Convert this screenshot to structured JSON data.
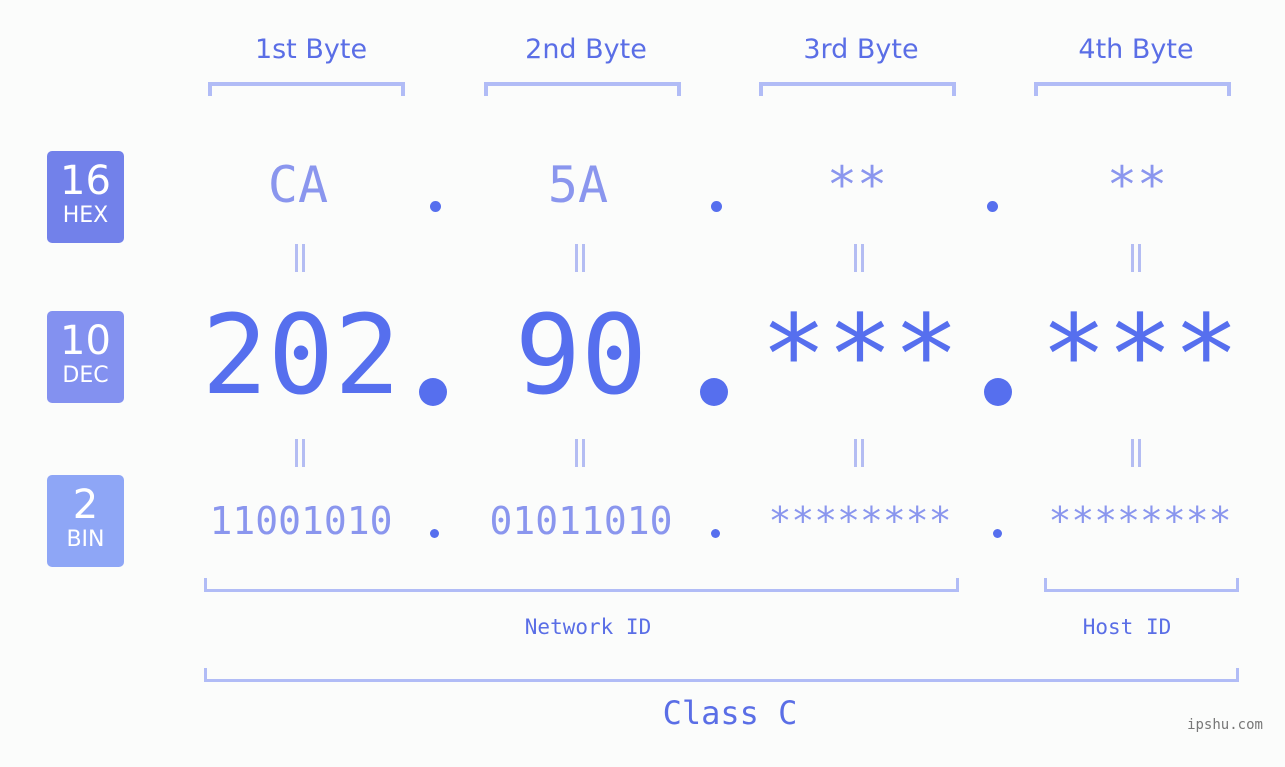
{
  "bases": [
    {
      "number": "16",
      "label": "HEX",
      "color": "#7281ea"
    },
    {
      "number": "10",
      "label": "DEC",
      "color": "#8391f0"
    },
    {
      "number": "2",
      "label": "BIN",
      "color": "#8ea6f6"
    }
  ],
  "bytes": [
    {
      "header": "1st Byte",
      "hex": "CA",
      "dec": "202",
      "bin": "11001010"
    },
    {
      "header": "2nd Byte",
      "hex": "5A",
      "dec": "90",
      "bin": "01011010"
    },
    {
      "header": "3rd Byte",
      "hex": "**",
      "dec": "***",
      "bin": "********"
    },
    {
      "header": "4th Byte",
      "hex": "**",
      "dec": "***",
      "bin": "********"
    }
  ],
  "equals_symbol": "=",
  "segments": {
    "network": "Network ID",
    "host": "Host ID"
  },
  "class_label": "Class C",
  "watermark": "ipshu.com",
  "colors": {
    "accent": "#566fee",
    "light": "#8a96ee",
    "bracket": "#b1bcf6"
  }
}
